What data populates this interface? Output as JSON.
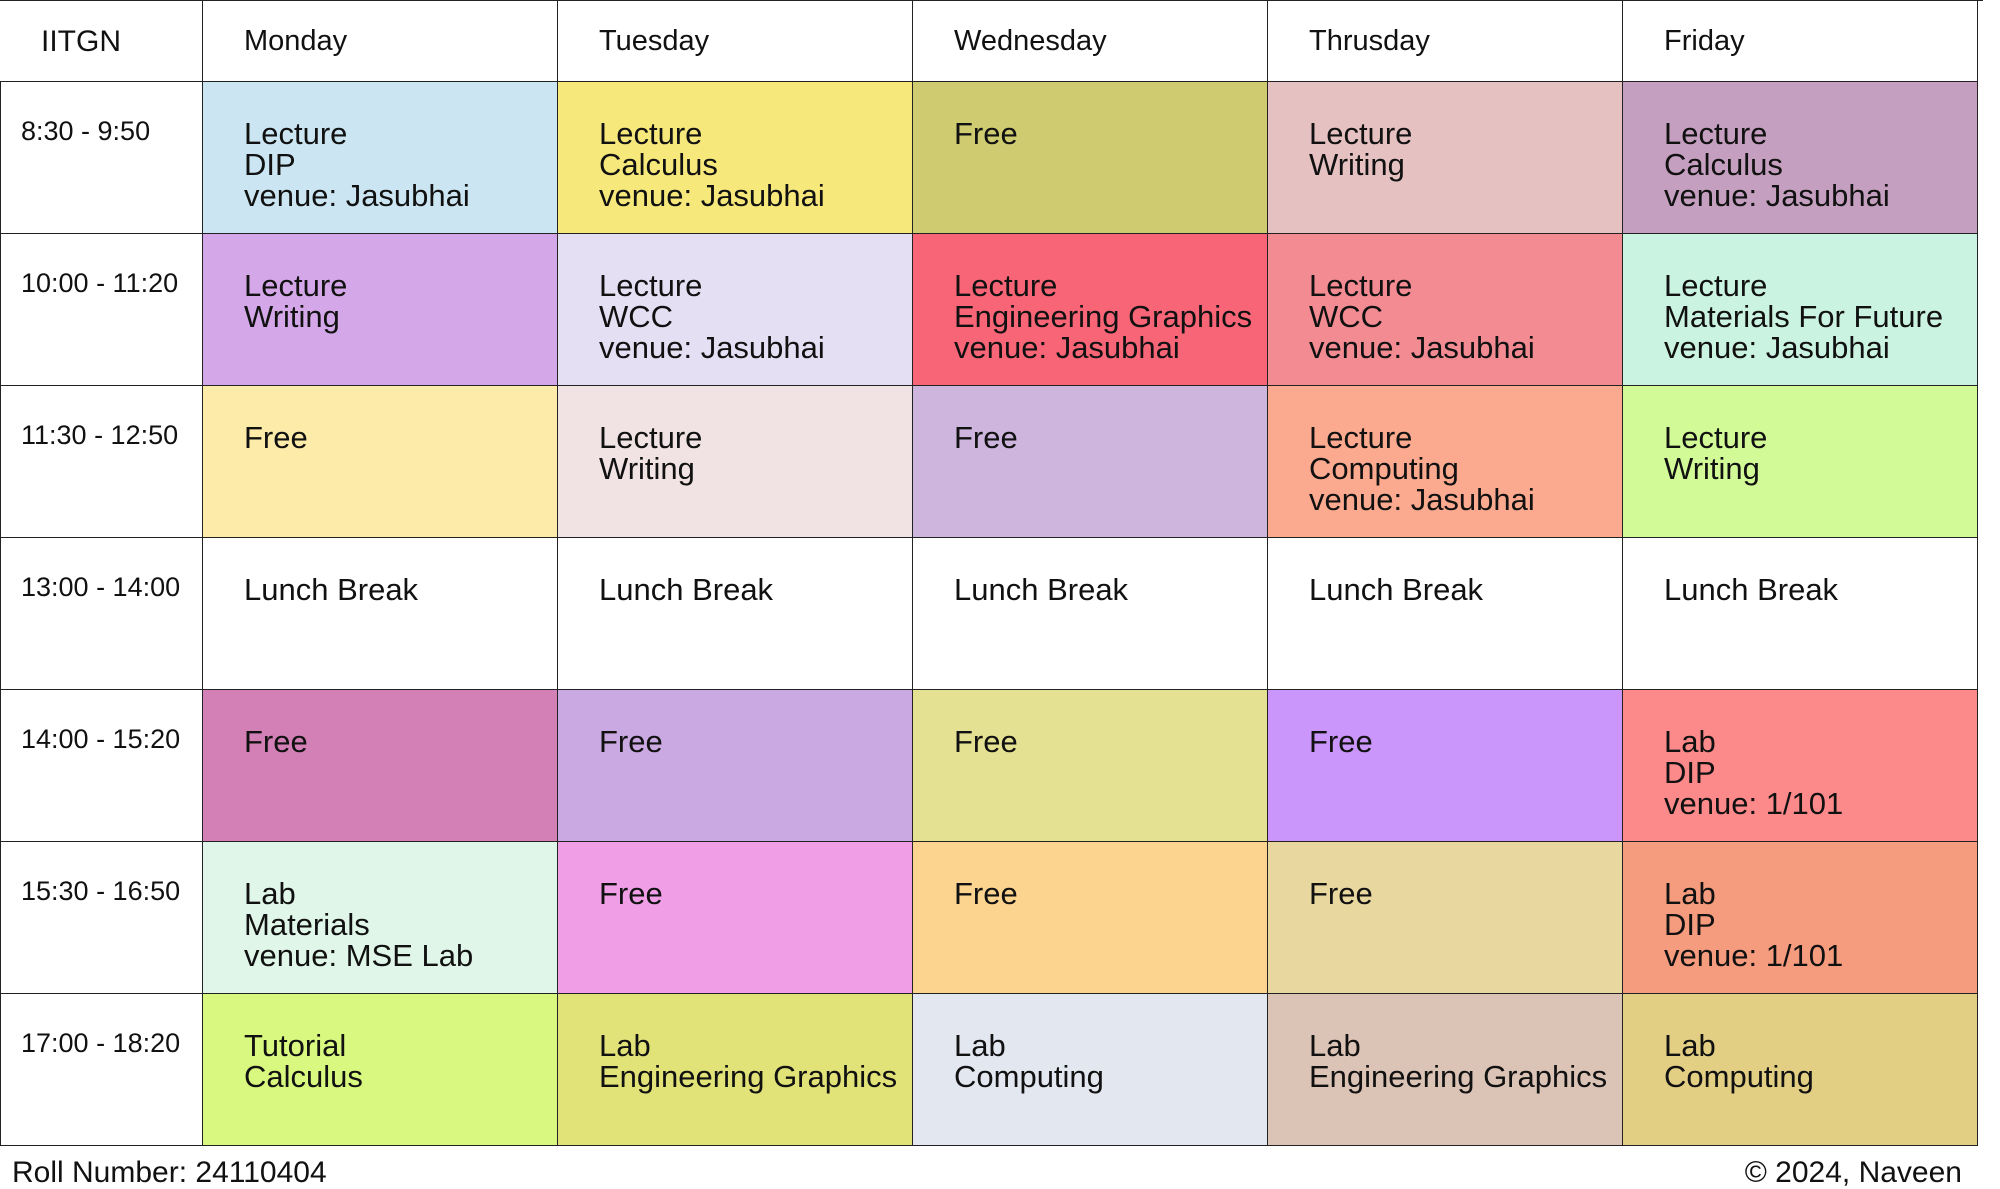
{
  "header": {
    "institute": "IITGN",
    "days": [
      "Monday",
      "Tuesday",
      "Wednesday",
      "Thrusday",
      "Friday"
    ]
  },
  "rows": [
    {
      "time": "8:30 - 9:50",
      "cells": [
        {
          "lines": [
            "Lecture",
            "DIP",
            "venue: Jasubhai"
          ],
          "color": "#cbe6f2"
        },
        {
          "lines": [
            "Lecture",
            "Calculus",
            "venue: Jasubhai"
          ],
          "color": "#f6e87b"
        },
        {
          "lines": [
            "Free"
          ],
          "color": "#cfcb71"
        },
        {
          "lines": [
            "Lecture",
            "Writing"
          ],
          "color": "#e5c1c1"
        },
        {
          "lines": [
            "Lecture",
            "Calculus",
            "venue: Jasubhai"
          ],
          "color": "#c49fbf"
        }
      ]
    },
    {
      "time": "10:00 - 11:20",
      "cells": [
        {
          "lines": [
            "Lecture",
            "Writing"
          ],
          "color": "#d4a8e8"
        },
        {
          "lines": [
            "Lecture",
            "WCC",
            "venue: Jasubhai"
          ],
          "color": "#e5dff4"
        },
        {
          "lines": [
            "Lecture",
            "Engineering Graphics",
            "venue: Jasubhai"
          ],
          "color": "#f76577"
        },
        {
          "lines": [
            "Lecture",
            "WCC",
            "venue: Jasubhai"
          ],
          "color": "#f38b93"
        },
        {
          "lines": [
            "Lecture",
            "Materials For Future",
            "venue: Jasubhai"
          ],
          "color": "#cbf3e1"
        }
      ]
    },
    {
      "time": "11:30 - 12:50",
      "cells": [
        {
          "lines": [
            "Free"
          ],
          "color": "#fdeba9"
        },
        {
          "lines": [
            "Lecture",
            "Writing"
          ],
          "color": "#f1e3e3"
        },
        {
          "lines": [
            "Free"
          ],
          "color": "#cdb5de"
        },
        {
          "lines": [
            "Lecture",
            "Computing",
            "venue: Jasubhai"
          ],
          "color": "#fcaa8f"
        },
        {
          "lines": [
            "Lecture",
            "Writing"
          ],
          "color": "#d2fb98"
        }
      ]
    },
    {
      "time": "13:00 - 14:00",
      "cells": [
        {
          "lines": [
            "Lunch Break"
          ],
          "color": "#ffffff"
        },
        {
          "lines": [
            "Lunch Break"
          ],
          "color": "#ffffff"
        },
        {
          "lines": [
            "Lunch Break"
          ],
          "color": "#ffffff"
        },
        {
          "lines": [
            "Lunch Break"
          ],
          "color": "#ffffff"
        },
        {
          "lines": [
            "Lunch Break"
          ],
          "color": "#ffffff"
        }
      ]
    },
    {
      "time": "14:00 - 15:20",
      "cells": [
        {
          "lines": [
            "Free"
          ],
          "color": "#d280b5"
        },
        {
          "lines": [
            "Free"
          ],
          "color": "#caa8e1"
        },
        {
          "lines": [
            "Free"
          ],
          "color": "#e4e192"
        },
        {
          "lines": [
            "Free"
          ],
          "color": "#ca96fb"
        },
        {
          "lines": [
            "Lab",
            "DIP",
            "venue: 1/101"
          ],
          "color": "#fc8a8a"
        }
      ]
    },
    {
      "time": "15:30 - 16:50",
      "cells": [
        {
          "lines": [
            "Lab",
            "Materials",
            "venue: MSE Lab"
          ],
          "color": "#e0f6e8"
        },
        {
          "lines": [
            "Free"
          ],
          "color": "#f09fe7"
        },
        {
          "lines": [
            "Free"
          ],
          "color": "#fcd48f"
        },
        {
          "lines": [
            "Free"
          ],
          "color": "#e9d7a0"
        },
        {
          "lines": [
            "Lab",
            "DIP",
            "venue: 1/101"
          ],
          "color": "#f59b7e"
        }
      ]
    },
    {
      "time": "17:00 - 18:20",
      "cells": [
        {
          "lines": [
            "Tutorial",
            "Calculus"
          ],
          "color": "#d9f880"
        },
        {
          "lines": [
            "Lab",
            "Engineering Graphics"
          ],
          "color": "#e1e378"
        },
        {
          "lines": [
            "Lab",
            "Computing"
          ],
          "color": "#e3e7f0"
        },
        {
          "lines": [
            "Lab",
            "Engineering Graphics"
          ],
          "color": "#dbc3b5"
        },
        {
          "lines": [
            "Lab",
            "Computing"
          ],
          "color": "#e2cf84"
        }
      ]
    }
  ],
  "footer": {
    "roll_number": "Roll Number: 24110404",
    "copyright": "© 2024, Naveen"
  }
}
